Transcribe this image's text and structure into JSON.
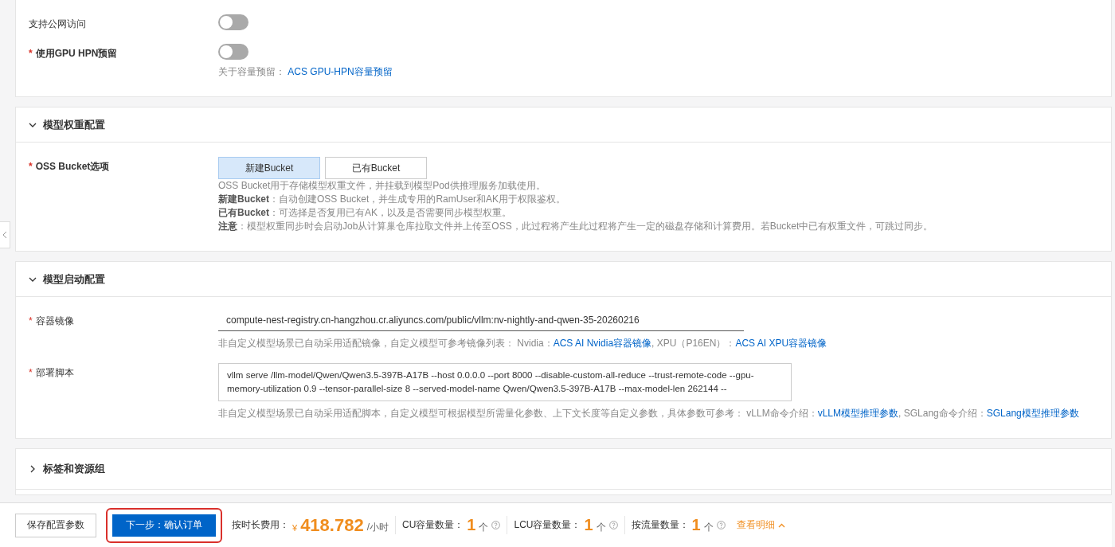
{
  "top_card": {
    "fields": [
      {
        "label": "支持公网访问",
        "on": false
      },
      {
        "label": "使用GPU HPN预留",
        "marker": "*",
        "on": false,
        "hint": "关于容量预留：",
        "link": "ACS GPU-HPN容量预留"
      }
    ]
  },
  "weights": {
    "title": "模型权重配置",
    "expanded": true,
    "label": "OSS Bucket选项",
    "marker": "*",
    "options": [
      {
        "label": "新建Bucket",
        "selected": true
      },
      {
        "label": "已有Bucket",
        "selected": false
      }
    ],
    "notes": [
      "OSS Bucket用于存储模型权重文件，并挂载到模型Pod供推理服务加载使用。",
      "**新建Bucket**：自动创建OSS Bucket，并生成专用的RamUser和AK用于权限鉴权。",
      "**已有Bucket**：可选择是否复用已有AK，以及是否需要同步模型权重。",
      "**注意**：模型权重同步时会启动Job从计算巢仓库拉取文件并上传至OSS，此过程将产生此过程将产生一定的磁盘存储和计算费用。若Bucket中已有权重文件，可跳过同步。"
    ]
  },
  "launch": {
    "title": "模型启动配置",
    "expanded": true,
    "image": {
      "label": "容器镜像",
      "marker": "*",
      "value": "compute-nest-registry.cn-hangzhou.cr.aliyuncs.com/public/vllm:nv-nightly-and-qwen-35-20260216",
      "help": [
        {
          "text": "非自定义模型场景已自动采用适配镜像，自定义模型可参考镜像列表： Nvidia："
        },
        {
          "link": "ACS AI Nvidia容器镜像"
        },
        {
          "text": ", XPU（P16EN）："
        },
        {
          "link": "ACS AI XPU容器镜像"
        }
      ]
    },
    "script": {
      "label": "部署脚本",
      "marker": "*",
      "value": "vllm serve /llm-model/Qwen/Qwen3.5-397B-A17B --host 0.0.0.0 --port 8000 --disable-custom-all-reduce --trust-remote-code --gpu-memory-utilization 0.9 --tensor-parallel-size 8 --served-model-name Qwen/Qwen3.5-397B-A17B --max-model-len 262144 --",
      "help": [
        {
          "text": "非自定义模型场景已自动采用适配脚本，自定义模型可根据模型所需量化参数、上下文长度等自定义参数，具体参数可参考： vLLM命令介绍："
        },
        {
          "link": "vLLM模型推理参数"
        },
        {
          "text": ", SGLang命令介绍："
        },
        {
          "link": "SGLang模型推理参数"
        }
      ]
    }
  },
  "tags": {
    "title": "标签和资源组",
    "expanded": false
  },
  "footer": {
    "save": "保存配置参数",
    "next": "下一步：确认订单",
    "next_highlighted": true,
    "cost_label": "按时长费用：",
    "currency": "¥",
    "amount": "418.782",
    "unit": "/小时",
    "counts": [
      {
        "label": "CU容量数量：",
        "value": "1",
        "unit": "个"
      },
      {
        "label": "LCU容量数量：",
        "value": "1",
        "unit": "个"
      },
      {
        "label": "按流量数量：",
        "value": "1",
        "unit": "个"
      }
    ],
    "details": "查看明细"
  }
}
